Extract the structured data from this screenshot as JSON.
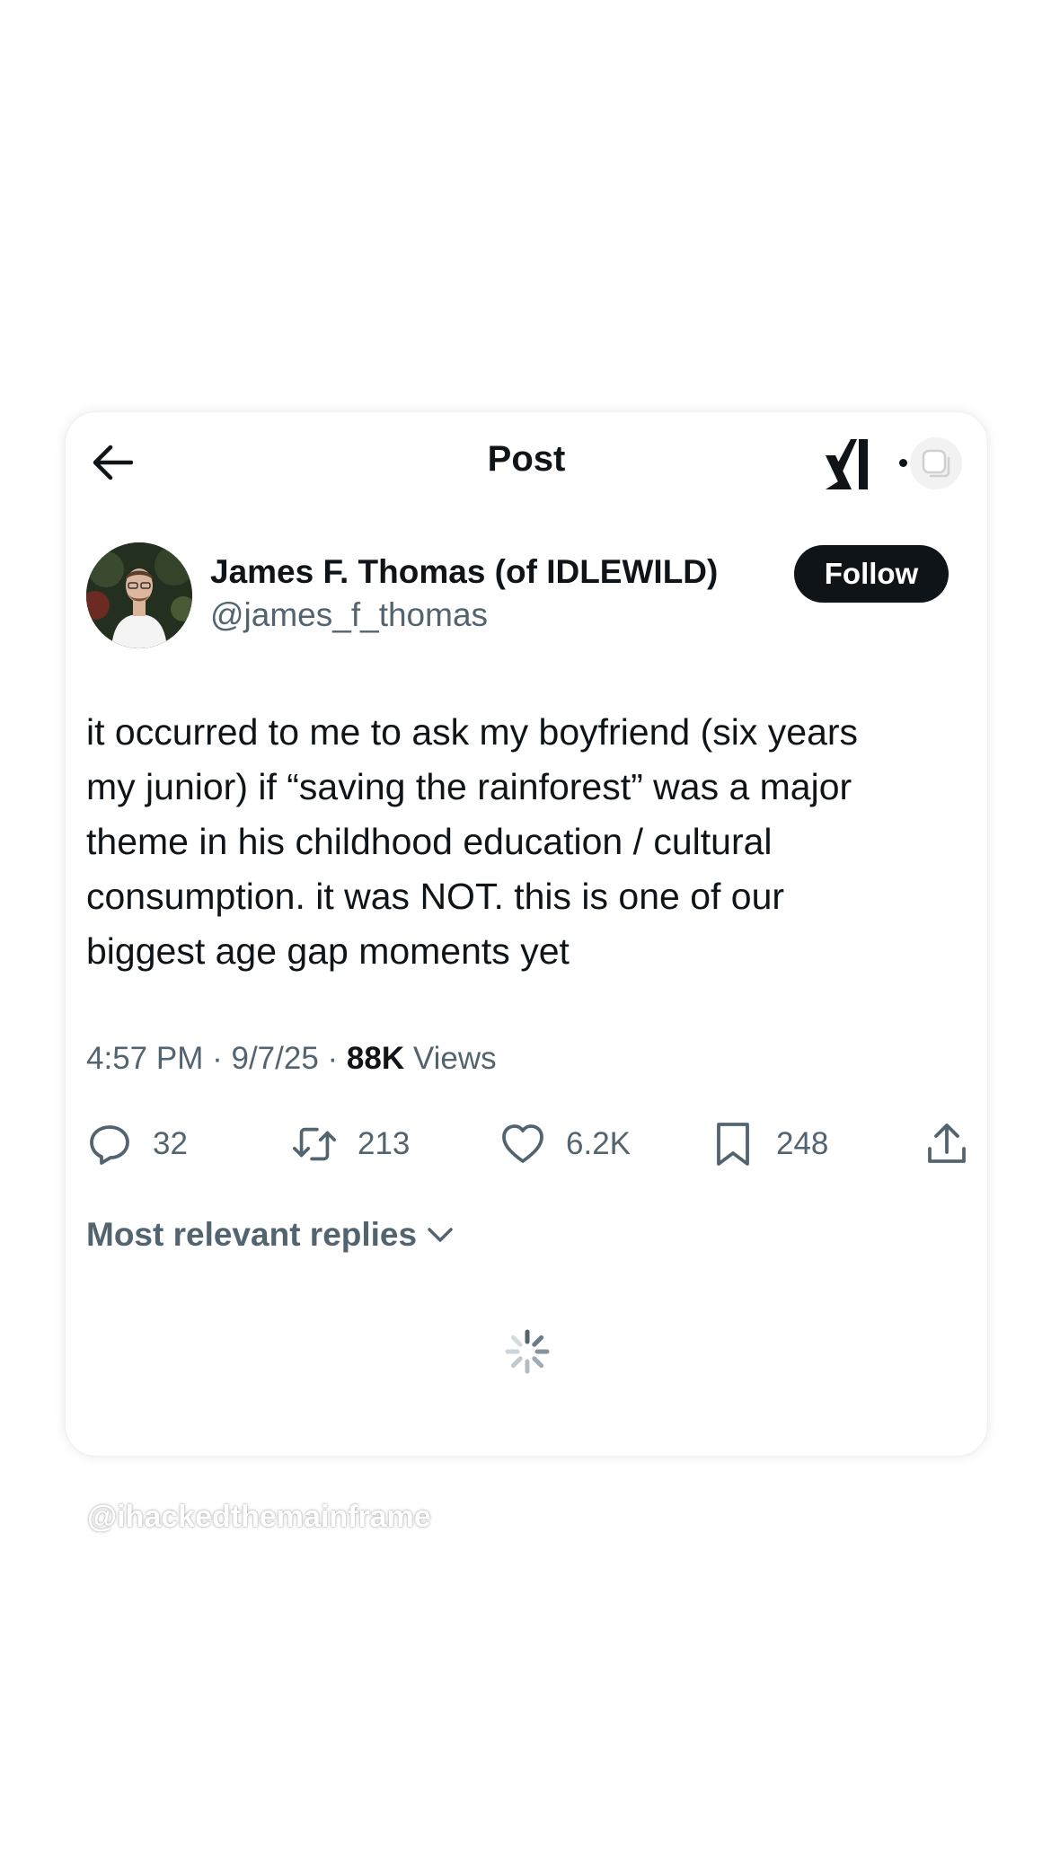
{
  "header": {
    "title": "Post",
    "back_icon": "arrow-left-icon",
    "grok_icon": "grok-logo-icon",
    "more_icon": "more-icon"
  },
  "author": {
    "display_name": "James F. Thomas (of IDLEWILD)",
    "handle": "@james_f_thomas",
    "follow_label": "Follow"
  },
  "post": {
    "lines": [
      "it occurred to me to ask my boyfriend (six years",
      "my junior) if “saving the rainforest” was a major",
      "theme in his childhood education / cultural",
      "consumption. it was NOT. this is one of our",
      "biggest age gap moments yet"
    ],
    "time": "4:57 PM",
    "date": "9/7/25",
    "separator": "·",
    "views_count": "88K",
    "views_label": "Views"
  },
  "actions": {
    "replies": "32",
    "reposts": "213",
    "likes": "6.2K",
    "bookmarks": "248"
  },
  "replies_sort": {
    "label": "Most relevant replies"
  },
  "watermark": "@ihackedthemainframe",
  "colors": {
    "text_primary": "#0f1419",
    "text_secondary": "#536471",
    "button_bg": "#0f1419",
    "card_bg": "#ffffff"
  }
}
